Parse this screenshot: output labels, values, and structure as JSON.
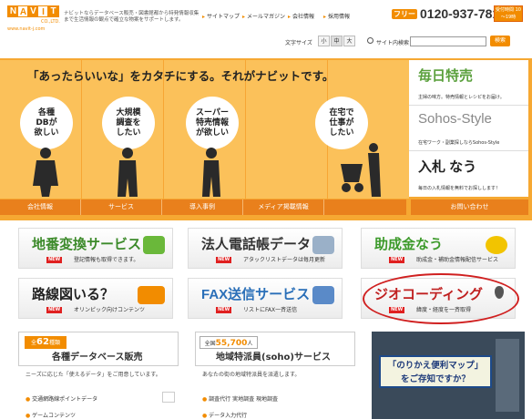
{
  "logo": {
    "letters": [
      "N",
      "A",
      "V",
      "I",
      "T"
    ],
    "co": "CO.,LTD.",
    "url": "www.navit-j.com"
  },
  "tagline": "ナビットならデータベース販売・図書館都から特発情報収集まで生活情報の観点で確立な物案をサポートします。",
  "toplinks": [
    "サイトマップ",
    "メールマガジン",
    "会社情報",
    "採用情報"
  ],
  "tel": {
    "label": "フリー",
    "number": "0120-937-781",
    "hours": "受付時間 10～19時"
  },
  "fontsize": {
    "label": "文字サイズ",
    "options": [
      "小",
      "中",
      "大"
    ]
  },
  "search": {
    "label": "サイト内検索",
    "button": "検索"
  },
  "hero": {
    "title": "「あったらいいな」をカタチにする。それがナビットです。",
    "people": [
      {
        "text": "各種\nDBが\n欲しい"
      },
      {
        "text": "大規模\n調査を\nしたい"
      },
      {
        "text": "スーパー\n特売情報\nが欲しい"
      },
      {
        "text": "在宅で\n仕事が\nしたい"
      }
    ]
  },
  "side": [
    {
      "title": "毎日特売",
      "desc": "主婦の味方。特売情報とレシピをお届け。",
      "color": "#5aa03c"
    },
    {
      "title": "Sohos-Style",
      "desc": "在宅ワーク・副業探しならSohos-Style",
      "color": "#888888"
    },
    {
      "title": "入札 なう",
      "desc": "毎日の入札情報を無料でお探しします！",
      "color": "#222222"
    }
  ],
  "nav": [
    "会社情報",
    "サービス",
    "導入事例",
    "メディア掲載情報",
    "お問い合わせ"
  ],
  "banners": [
    {
      "title": "地番変換サービス",
      "desc": "登記情報も取得できます。",
      "color": "#3c8a2a",
      "icon": "#6ab83a"
    },
    {
      "title": "法人電話帳データ",
      "desc": "アタックリストデータは毎月更新",
      "color": "#333333",
      "icon": "#9ab0c8"
    },
    {
      "title": "助成金なう",
      "desc": "助成金・補助金情報配信サービス",
      "color": "#3c9a2a",
      "icon": "#f2c400"
    },
    {
      "title": "路線図いる？",
      "desc": "オリンピック向けコンテンツ",
      "color": "#222222",
      "icon": "#f28c00"
    },
    {
      "title": "FAX送信サービス",
      "desc": "リストにFAX一斉送信",
      "color": "#2a6fb8",
      "icon": "#5a8ac8"
    },
    {
      "title": "ジオコーディング",
      "desc": "緯度・経度を一斉取得",
      "color": "#c02020",
      "icon": "#555555"
    }
  ],
  "new_badge": "NEW",
  "cards": [
    {
      "count_pre": "全",
      "count": "62",
      "count_post": "種類",
      "title": "各種データベース販売",
      "desc": "ニーズに応じた「使えるデータ」をご用意しています。",
      "links": [
        "交通網路線ポイントデータ",
        "ゲームコンテンツ"
      ]
    },
    {
      "count_pre": "全国",
      "count": "55,700",
      "count_post": "人",
      "title": "地域特派員(soho)サービス",
      "desc": "あなたの街の地域特派員を派遣します。",
      "links": [
        "調査代行 実地調査 現地調査",
        "データ入力代行"
      ]
    }
  ],
  "map": {
    "line1": "「のりかえ便利マップ」",
    "line2": "をご存知ですか？"
  }
}
